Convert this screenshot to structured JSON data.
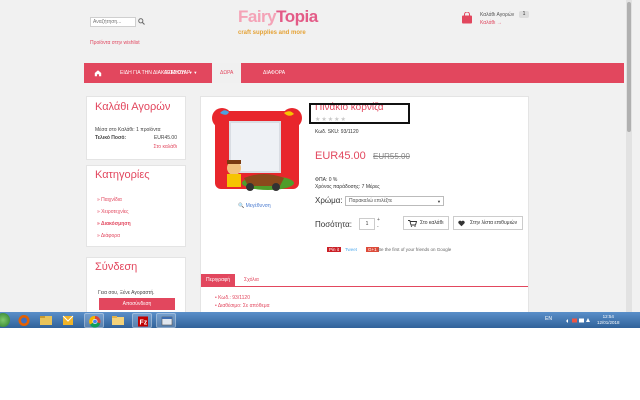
{
  "header": {
    "search_placeholder": "Αναζήτηση...",
    "wishlist_link": "Προϊόντα στην wishlist",
    "logo_fairy": "Fairy",
    "logo_topia": "Topia",
    "logo_subtitle": "craft supplies and more",
    "cart_title": "Καλάθι Αγορών",
    "cart_count": "1",
    "cart_sub": "Καλάθι →"
  },
  "nav": {
    "items": [
      {
        "label": "ΕΙΔΗ ΓΙΑ ΤΗΝ ΔΙΑΚΟΣΜΗΣΗ"
      },
      {
        "label": "ΑΞΕΣΟΥΑΡ"
      },
      {
        "label": "ΔΩΡΑ"
      },
      {
        "label": "ΔΙΑΦΟΡΑ"
      }
    ]
  },
  "sidebar": {
    "cart_panel": {
      "title": "Καλάθι Αγορών",
      "line1": "Μέσα στο Καλάθι: 1 προϊόντα",
      "total_label": "Τελικό Ποσό:",
      "total_value": "EUR45.00",
      "view_link": "Στο καλάθι"
    },
    "categories": {
      "title": "Κατηγορίες",
      "items": [
        {
          "label": "Παιχνίδια"
        },
        {
          "label": "Χειροτεχνίες"
        },
        {
          "label": "Διακόσμηση"
        },
        {
          "label": "Διάφορα"
        }
      ]
    },
    "login": {
      "title": "Σύνδεση",
      "greeting": "Γεια σου, Ξένε Αγοραστή.",
      "button": "Αποσύνδεση"
    }
  },
  "product": {
    "title": "Πινάκιο κορνίζα",
    "stars": "★★★★★",
    "code": "Κωδ. SKU: 93/1120",
    "price": "EUR45.00",
    "old_price": "EUR55.00",
    "vat": "ΦΠΑ: 0 %",
    "dispatch": "Χρόνος παράδοσης: 7 Μέρες",
    "color_label": "Χρώμα:",
    "color_select": "Παρακαλώ επιλέξτε",
    "qty_label": "Ποσότητα:",
    "qty_value": "1",
    "add_cart": "Στο καλάθι",
    "wishlist": "Στην λίστα επιθυμιών",
    "zoom_link": "Μεγέθυνση",
    "social_pin": "Pin it",
    "social_tweet": "Tweet",
    "social_gplus": "Be the first of your friends on Google",
    "tabs": [
      {
        "label": "Περιγραφή"
      },
      {
        "label": "Σχόλια"
      }
    ],
    "details": [
      "Κωδ.: 93/1120",
      "Διαθέσιμο: Σε απόθεμα"
    ]
  },
  "taskbar": {
    "lang": "EN",
    "time": "12:54",
    "date": "12/01/2018"
  },
  "colors": {
    "accent": "#e2475e",
    "background": "#f1f1f1"
  }
}
